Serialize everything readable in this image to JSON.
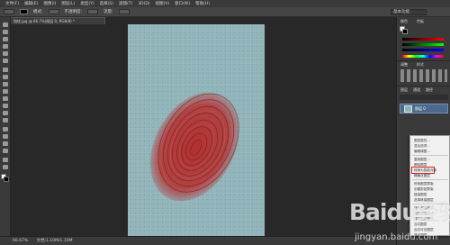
{
  "menubar": {
    "items": [
      "文件(F)",
      "编辑(E)",
      "图像(I)",
      "图层(L)",
      "类型(Y)",
      "选择(S)",
      "滤镜(T)",
      "3D(D)",
      "视图(V)",
      "窗口(W)",
      "帮助(H)"
    ]
  },
  "optionsbar": {
    "mode_label": "模式:",
    "opacity_label": "不透明度:",
    "flow_label": "流量:",
    "workspace": "基本功能"
  },
  "document": {
    "tab_title": "指纹.jpg @ 66.7%(图层 0, RGB/8) *"
  },
  "statusbar": {
    "zoom": "66.67%",
    "doc_info": "文档:1.10M/1.10M"
  },
  "panels": {
    "color_tabs": [
      "颜色",
      "色板"
    ],
    "adjust_tabs": [
      "调整",
      "样式"
    ],
    "layer_tabs": [
      "图层",
      "通道",
      "路径"
    ],
    "layer_name": "图层 0"
  },
  "context_menu": {
    "items": [
      "图层属性...",
      "混合选项...",
      "编辑调整...",
      "复制图层...",
      "删除图层",
      "转换为智能对象",
      "栅格化图层",
      "停用图层蒙版",
      "创建剪贴蒙版",
      "链接图层",
      "选择链接图层",
      "拷贝图层样式",
      "粘贴图层样式",
      "清除图层样式",
      "合并图层",
      "合并可见图层",
      "拼合图像",
      "无颜色",
      "红色",
      "橙色"
    ],
    "highlighted_item": "栅格化图层"
  },
  "watermark": {
    "logo": "Baidu经验",
    "url": "jingyan.baidu.com"
  },
  "colors": {
    "canvas": "#8fb4ba",
    "fingerprint": "#b22a2a",
    "highlight": "#e02020"
  }
}
